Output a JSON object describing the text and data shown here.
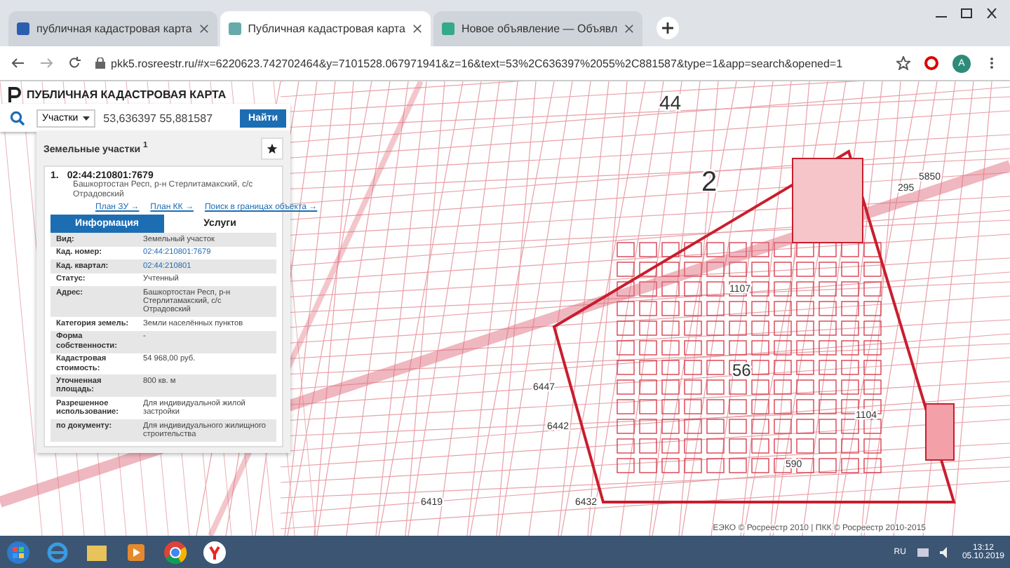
{
  "browser": {
    "tabs": [
      {
        "title": "публичная кадастровая карта",
        "selected": false
      },
      {
        "title": "Публичная кадастровая карта",
        "selected": true
      },
      {
        "title": "Новое объявление — Объявл",
        "selected": false
      }
    ],
    "url": "pkk5.rosreestr.ru/#x=6220623.742702464&y=7101528.067971941&z=16&text=53%2C636397%2055%2C881587&type=1&app=search&opened=1",
    "profile_initial": "A"
  },
  "header": {
    "title": "ПУБЛИЧНАЯ КАДАСТРОВАЯ КАРТА"
  },
  "search": {
    "type": "Участки",
    "value": "53,636397 55,881587",
    "button": "Найти"
  },
  "results": {
    "heading": "Земельные участки $^{1}$",
    "item": {
      "index": "1.",
      "number": "02:44:210801:7679",
      "address": "Башкортостан Респ, р-н Стерлитамакский, с/с Отрадовский",
      "links": [
        "План ЗУ →",
        "План КК →",
        "Поиск в границах объекта →"
      ]
    },
    "tabs": [
      {
        "label": "Информация",
        "selected": true
      },
      {
        "label": "Услуги",
        "selected": false
      }
    ],
    "rows": [
      {
        "label": "Вид:",
        "value": "Земельный участок",
        "kind": "text"
      },
      {
        "label": "Кад. номер:",
        "value": "02:44:210801:7679",
        "kind": "link"
      },
      {
        "label": "Кад. квартал:",
        "value": "02:44:210801",
        "kind": "link"
      },
      {
        "label": "Статус:",
        "value": "Учтенный",
        "kind": "text"
      },
      {
        "label": "Адрес:",
        "value": "Башкортостан Респ, р-н Стерлитамакский, с/с Отрадовский",
        "kind": "text"
      },
      {
        "label": "Категория земель:",
        "value": "Земли населённых пунктов",
        "kind": "text"
      },
      {
        "label": "Форма собственности:",
        "value": "-",
        "kind": "text"
      },
      {
        "label": "Кадастровая стоимость:",
        "value": "54 968,00 руб.",
        "kind": "text"
      },
      {
        "label": "Уточненная площадь:",
        "value": "800 кв. м",
        "kind": "text"
      },
      {
        "label": "Разрешенное использование:",
        "value": "Для индивидуальной жилой застройки",
        "kind": "text"
      },
      {
        "label": "по документу:",
        "value": "Для индивидуального жилищного строительства",
        "kind": "text"
      }
    ]
  },
  "map": {
    "labels": [
      "44",
      "2",
      "56",
      "6447",
      "6442",
      "6419",
      "6432",
      "590",
      "1104",
      "1107",
      "5850",
      "295"
    ],
    "attribution": "ЕЭКО © Росреестр 2010 | ПКК © Росреестр 2010-2015"
  },
  "taskbar": {
    "language": "RU",
    "time": "13:12",
    "date": "05.10.2019"
  }
}
